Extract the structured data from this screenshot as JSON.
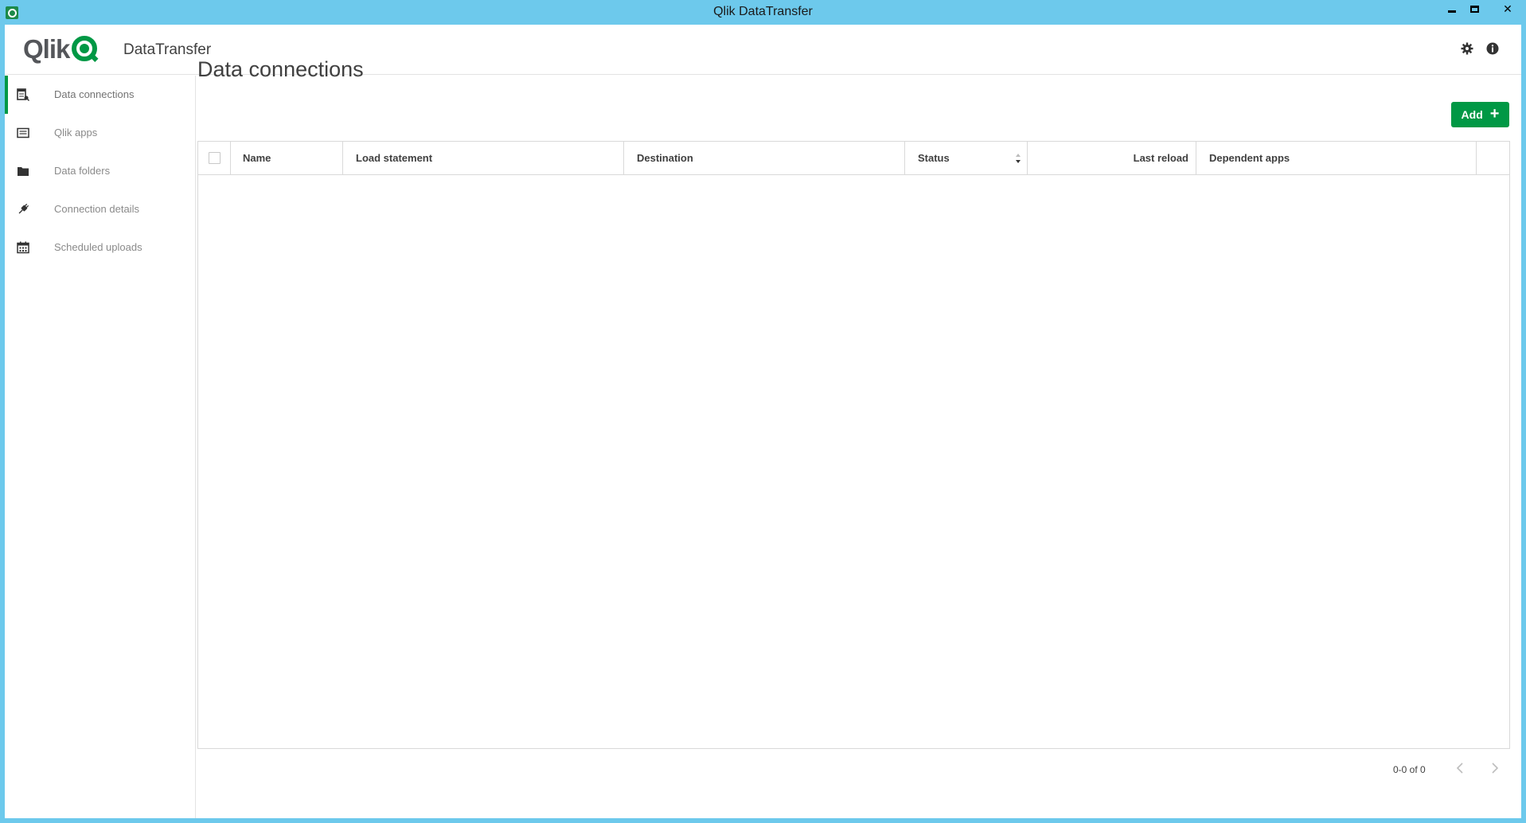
{
  "window": {
    "title": "Qlik DataTransfer",
    "controls": {
      "minimize": "",
      "maximize": "",
      "close": "✕"
    }
  },
  "header": {
    "logo_word": "Qlik",
    "product_name": "DataTransfer",
    "icons": [
      "gear-icon",
      "info-icon"
    ]
  },
  "sidebar": {
    "items": [
      {
        "label": "Data connections",
        "icon": "data-connections-icon",
        "active": true
      },
      {
        "label": "Qlik apps",
        "icon": "qlik-apps-icon",
        "active": false
      },
      {
        "label": "Data folders",
        "icon": "folder-icon",
        "active": false
      },
      {
        "label": "Connection details",
        "icon": "plug-icon",
        "active": false
      },
      {
        "label": "Scheduled uploads",
        "icon": "calendar-icon",
        "active": false
      }
    ]
  },
  "main": {
    "title": "Data connections",
    "add_label": "Add",
    "table": {
      "columns": [
        "Name",
        "Load statement",
        "Destination",
        "Status",
        "Last reload",
        "Dependent apps"
      ],
      "rows": []
    },
    "pagination": {
      "text": "0-0 of 0"
    }
  },
  "colors": {
    "accent": "#009845",
    "titlebar": "#6dc9ec",
    "text": "#404040"
  }
}
